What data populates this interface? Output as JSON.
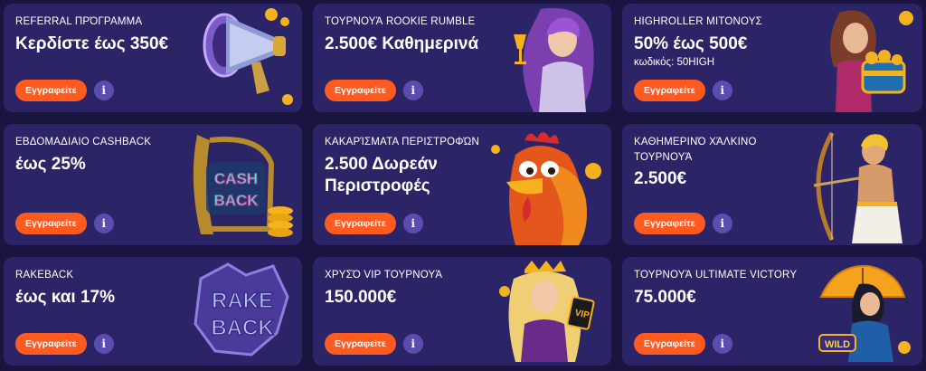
{
  "promos": [
    {
      "eyebrow": "REFERRAL ΠΡΌΓΡΑΜΜΑ",
      "headline": "Κερδίστε έως 350€",
      "sub": "",
      "button": "Εγγραφείτε",
      "art": "megaphone-icon"
    },
    {
      "eyebrow": "ΤΟΥΡΝΟΥΆ ROOKIE RUMBLE",
      "headline": "2.500€ Καθημερινά",
      "sub": "",
      "button": "Εγγραφείτε",
      "art": "goddess-with-goblet-icon"
    },
    {
      "eyebrow": "HIGHROLLER ΜΙΤΟΝΟΥΣ",
      "headline": "50% έως 500€",
      "sub": "κωδικός: 50HIGH",
      "button": "Εγγραφείτε",
      "art": "treasure-chest-lady-icon"
    },
    {
      "eyebrow": "ΕΒΔΟΜΑΔΙΑΙΟ CASHBACK",
      "headline": "έως 25%",
      "sub": "",
      "button": "Εγγραφείτε",
      "art": "cashback-harp-icon",
      "art_text": [
        "CASH",
        "BACK"
      ]
    },
    {
      "eyebrow": "ΚΑΚΑΡΊΣΜΑΤΑ ΠΕΡΙΣΤΡΟΦΏΝ",
      "headline": "2.500 Δωρεάν Περιστροφές",
      "sub": "",
      "button": "Εγγραφείτε",
      "art": "rooster-icon"
    },
    {
      "eyebrow": "ΚΑΘΗΜΕΡΙΝΌ ΧΆΛΚΙΝΟ ΤΟΥΡΝΟΥΆ",
      "headline": "2.500€",
      "sub": "",
      "button": "Εγγραφείτε",
      "art": "archer-god-icon"
    },
    {
      "eyebrow": "RAKEBACK",
      "headline": "έως και 17%",
      "sub": "",
      "button": "Εγγραφείτε",
      "art": "rakeback-logo-icon",
      "art_text": [
        "RAKE",
        "BACK"
      ]
    },
    {
      "eyebrow": "ΧΡΥΣΌ VIP ΤΟΥΡΝΟΥΆ",
      "headline": "150.000€",
      "sub": "",
      "button": "Εγγραφείτε",
      "art": "vip-queen-icon",
      "art_text": [
        "VIP"
      ]
    },
    {
      "eyebrow": "ΤΟΥΡΝΟΥΆ ULTIMATE VICTORY",
      "headline": "75.000€",
      "sub": "",
      "button": "Εγγραφείτε",
      "art": "umbrella-lady-icon",
      "art_text": [
        "WILD"
      ]
    }
  ],
  "colors": {
    "page_bg": "#1a1540",
    "card_bg": "#2b2466",
    "button": "#ff5a1f",
    "info": "#5b4db0",
    "gold": "#f5b21f"
  }
}
